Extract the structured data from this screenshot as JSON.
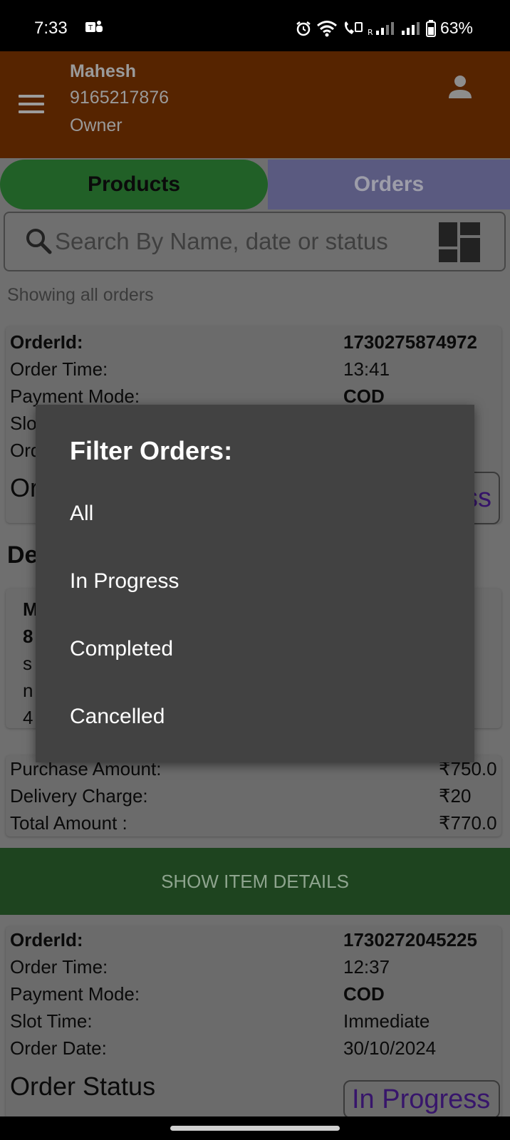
{
  "status_bar": {
    "time": "7:33",
    "battery": "63%",
    "icons": [
      "teams-icon",
      "alarm-icon",
      "wifi-icon",
      "wifi-call-icon",
      "signal-icon",
      "signal-icon",
      "battery-icon"
    ]
  },
  "header": {
    "name": "Mahesh",
    "phone": "9165217876",
    "role": "Owner",
    "menu_icon": "hamburger-menu-icon",
    "user_icon": "account-icon",
    "bg_color": "#562400"
  },
  "tabs": {
    "products": "Products",
    "orders": "Orders"
  },
  "search": {
    "placeholder": "Search By Name, date or status",
    "value": ""
  },
  "showing_text": "Showing all orders",
  "order1": {
    "order_id_label": "OrderId:",
    "order_id": "1730275874972",
    "order_time_label": "Order Time:",
    "order_time": "13:41",
    "payment_label": "Payment Mode:",
    "payment": "COD",
    "slot_label_partial": "Slo",
    "order_date_label_partial": "Ord",
    "status_label_partial": "Or",
    "status_partial": "ss",
    "section_partial": "De",
    "address_lines_partial": [
      "M",
      "8",
      "s",
      "n",
      "4"
    ],
    "purchase_label": "Purchase Amount:",
    "purchase": "₹750.0",
    "delivery_label": "Delivery Charge:",
    "delivery": "₹20",
    "total_label": "Total Amount :",
    "total": "₹770.0"
  },
  "show_item_details": "SHOW ITEM DETAILS",
  "order2": {
    "order_id_label": "OrderId:",
    "order_id": "1730272045225",
    "order_time_label": "Order Time:",
    "order_time": "12:37",
    "payment_label": "Payment Mode:",
    "payment": "COD",
    "slot_label": "Slot Time:",
    "slot": "Immediate",
    "order_date_label": "Order Date:",
    "order_date": "30/10/2024",
    "status_label": "Order Status",
    "status": "In Progress"
  },
  "filter_dialog": {
    "title": "Filter Orders:",
    "options": [
      "All",
      "In Progress",
      "Completed",
      "Cancelled"
    ]
  },
  "colors": {
    "products_tab": "#216027",
    "orders_tab": "#5a5a80",
    "show_item_button": "#1e441f",
    "dialog": "#424242",
    "status_text": "#37156b"
  }
}
